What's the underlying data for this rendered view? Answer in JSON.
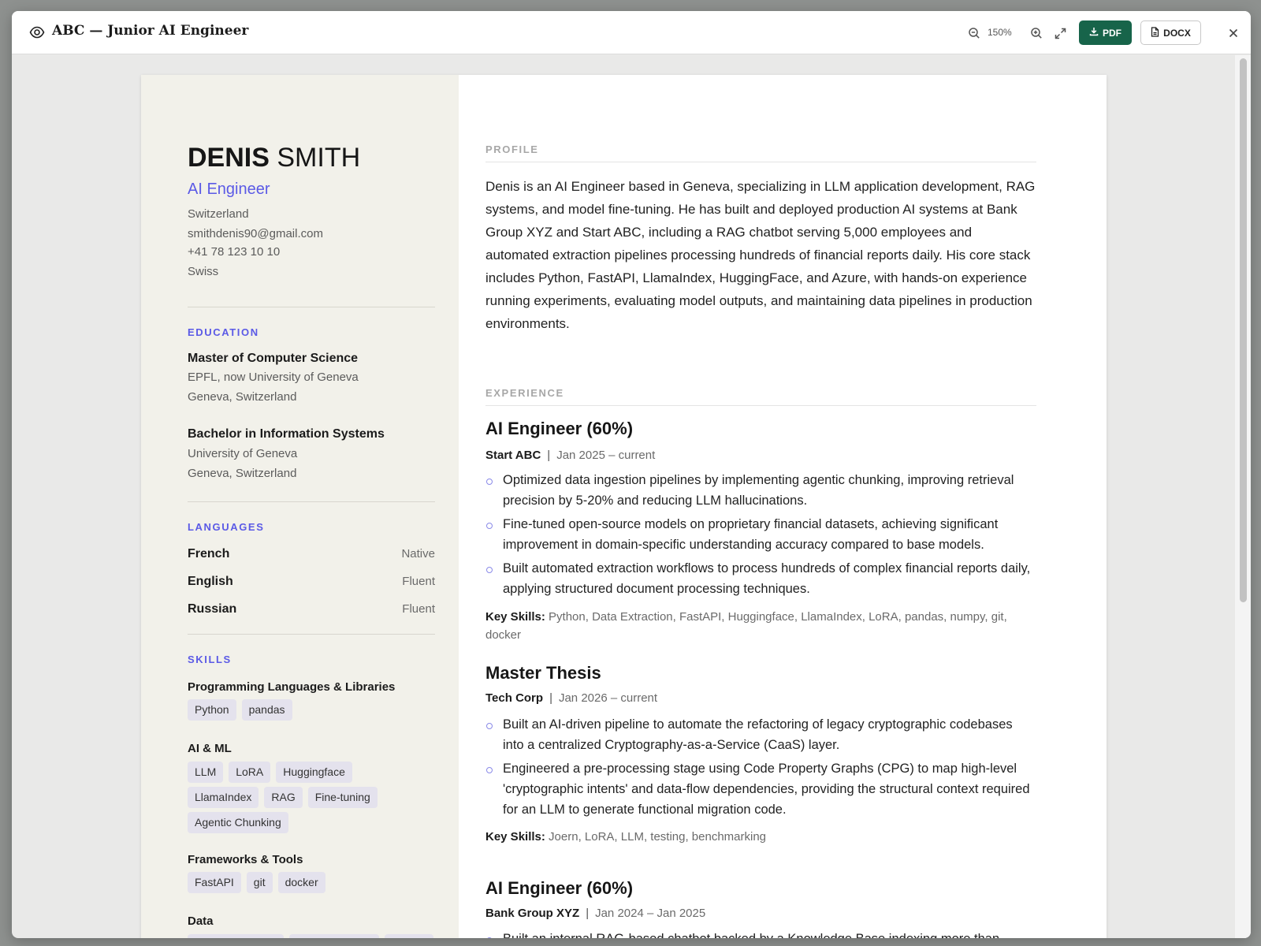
{
  "window": {
    "title": "ABC — Junior AI Engineer",
    "zoom": "150%",
    "pdf_label": "PDF",
    "docx_label": "DOCX",
    "icons": [
      "eye-icon",
      "zoom-out-icon",
      "zoom-in-icon",
      "expand-icon",
      "download-icon",
      "file-icon",
      "close-icon"
    ]
  },
  "resume": {
    "first_name": "DENIS",
    "last_name": "SMITH",
    "role": "AI Engineer",
    "contact": {
      "country": "Switzerland",
      "email": "smithdenis90@gmail.com",
      "phone": "+41 78 123 10 10",
      "nationality": "Swiss"
    },
    "education": {
      "heading": "EDUCATION",
      "items": [
        {
          "degree": "Master of Computer Science",
          "school": "EPFL, now University of Geneva",
          "location": "Geneva, Switzerland"
        },
        {
          "degree": "Bachelor in Information Systems",
          "school": "University of Geneva",
          "location": "Geneva, Switzerland"
        }
      ]
    },
    "languages": {
      "heading": "LANGUAGES",
      "items": [
        {
          "name": "French",
          "level": "Native"
        },
        {
          "name": "English",
          "level": "Fluent"
        },
        {
          "name": "Russian",
          "level": "Fluent"
        }
      ]
    },
    "skills": {
      "heading": "SKILLS",
      "categories": [
        {
          "name": "Programming Languages & Libraries",
          "rows": [
            [
              "Python",
              "pandas"
            ]
          ]
        },
        {
          "name": "AI & ML",
          "rows": [
            [
              "LLM",
              "LoRA",
              "Huggingface"
            ],
            [
              "LlamaIndex",
              "RAG",
              "Fine-tuning"
            ],
            [
              "Agentic Chunking"
            ]
          ]
        },
        {
          "name": "Frameworks & Tools",
          "rows": [
            [
              "FastAPI",
              "git",
              "docker"
            ]
          ]
        },
        {
          "name": "Data",
          "rows": []
        }
      ]
    },
    "profile": {
      "heading": "PROFILE",
      "text": "Denis is an AI Engineer based in Geneva, specializing in LLM application development, RAG systems, and model fine-tuning. He has built and deployed production AI systems at Bank Group XYZ and Start ABC, including a RAG chatbot serving 5,000 employees and automated extraction pipelines processing hundreds of financial reports daily. His core stack includes Python, FastAPI, LlamaIndex, HuggingFace, and Azure, with hands-on experience running experiments, evaluating model outputs, and maintaining data pipelines in production environments."
    },
    "experience": {
      "heading": "EXPERIENCE",
      "key_skills_label": "Key Skills:",
      "jobs": [
        {
          "title": "AI Engineer (60%)",
          "company": "Start ABC",
          "dates": "Jan 2025 – current",
          "bullets": [
            "Optimized data ingestion pipelines by implementing agentic chunking, improving retrieval precision by 5-20% and reducing LLM hallucinations.",
            "Fine-tuned open-source models on proprietary financial datasets, achieving significant improvement in domain-specific understanding accuracy compared to base models.",
            "Built automated extraction workflows to process hundreds of complex financial reports daily, applying structured document processing techniques."
          ],
          "key_skills": "Python, Data Extraction, FastAPI, Huggingface, LlamaIndex, LoRA, pandas, numpy, git, docker"
        },
        {
          "title": "Master Thesis",
          "company": "Tech Corp",
          "dates": "Jan 2026 – current",
          "bullets": [
            "Built an AI-driven pipeline to automate the refactoring of legacy cryptographic codebases into a centralized Cryptography-as-a-Service (CaaS) layer.",
            "Engineered a pre-processing stage using Code Property Graphs (CPG) to map high-level 'cryptographic intents' and data-flow dependencies, providing the structural context required for an LLM to generate functional migration code."
          ],
          "key_skills": "Joern, LoRA, LLM, testing, benchmarking"
        },
        {
          "title": "AI Engineer (60%)",
          "company": "Bank Group XYZ",
          "dates": "Jan 2024 – Jan 2025",
          "bullets": [
            "Built an internal RAG-based chatbot backed by a Knowledge Base indexing more than"
          ],
          "key_skills": ""
        }
      ]
    }
  },
  "colors": {
    "accent": "#5b5ae6",
    "pdf_button": "#17644a",
    "sidebar_bg": "#f2f1ea",
    "chip_bg": "#e4e2ed"
  }
}
